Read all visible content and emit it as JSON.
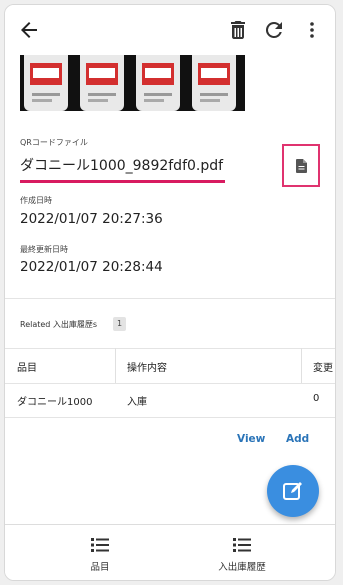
{
  "toolbar": {
    "back_icon": "arrow-back-icon",
    "delete_icon": "trash-icon",
    "refresh_icon": "refresh-icon",
    "more_icon": "more-vert-icon"
  },
  "detail": {
    "qr_file_label": "QRコードファイル",
    "qr_file_value": "ダコニール1000_9892fdf0.pdf",
    "created_label": "作成日時",
    "created_value": "2022/01/07 20:27:36",
    "updated_label": "最終更新日時",
    "updated_value": "2022/01/07 20:28:44"
  },
  "related": {
    "title": "Related 入出庫履歴s",
    "count": "1",
    "columns": [
      "品目",
      "操作内容",
      "変更"
    ],
    "rows": [
      [
        "ダコニール1000",
        "入庫",
        "0"
      ]
    ],
    "view_label": "View",
    "add_label": "Add"
  },
  "bottom_nav": [
    {
      "label": "品目",
      "icon": "list-icon"
    },
    {
      "label": "入出庫履歴",
      "icon": "list-icon"
    }
  ],
  "colors": {
    "accent": "#d81b60",
    "link": "#2a74b8",
    "fab": "#3a8ee0"
  }
}
